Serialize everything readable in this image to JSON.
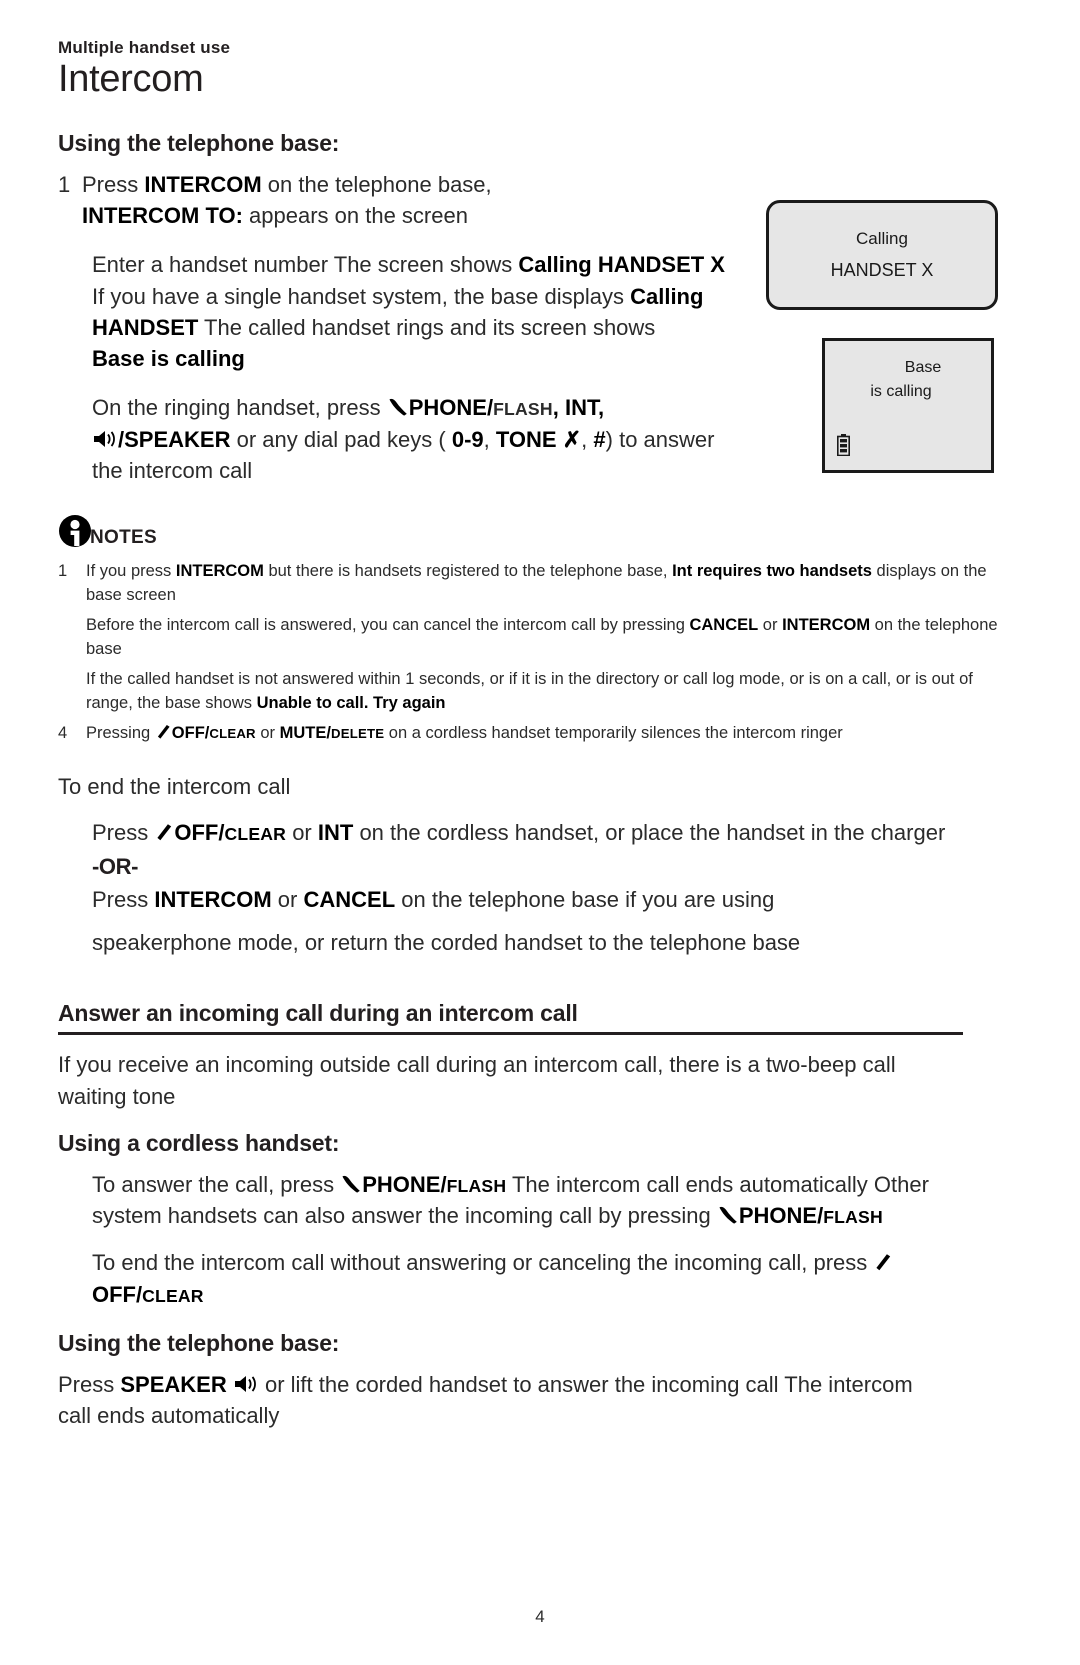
{
  "header": {
    "running_head": "Multiple handset use",
    "chapter_title": "Intercom"
  },
  "section_using_base": {
    "heading": "Using the telephone base:",
    "step1": {
      "number": "1",
      "line1_a": "Press ",
      "line1_b": "INTERCOM",
      "line1_c": " on the telephone base,",
      "line2_b": "INTERCOM TO:",
      "line2_c": " appears on the screen"
    },
    "para2": {
      "a": "Enter a handset number The screen shows ",
      "b": "Calling HANDSET X",
      "c": " If you have a single handset system, the base  displays ",
      "d": "Calling HANDSET",
      "e": " The called handset rings and its screen shows ",
      "f": "Base is calling"
    },
    "para3": {
      "a": "On the ringing handset, press ",
      "phone_icon": "phone-handset-icon",
      "b": "PHONE/",
      "b_sc": "FLASH",
      "c": ", ",
      "d": "INT",
      "e": ", ",
      "speaker_icon": "speaker-icon",
      "f": "/SPEAKER",
      "g": " or any dial pad keys ( ",
      "h": "0",
      "i": "-",
      "j": "9",
      "k": ", ",
      "l": "TONE ",
      "m": "✗",
      "n": ", ",
      "o": "#",
      "p": ") to answer the intercom call"
    }
  },
  "screens": {
    "base_screen": {
      "line1": "Calling",
      "line2": "HANDSET X"
    },
    "handset_screen": {
      "line1": "Base",
      "line2": "is calling",
      "battery_icon": "battery-full-icon"
    }
  },
  "notes": {
    "icon": "info-icon",
    "label": "NOTES",
    "items": [
      {
        "number": "1",
        "parts": [
          {
            "t": "If you press ",
            "b": false
          },
          {
            "t": "INTERCOM",
            "b": true
          },
          {
            "t": " but there is handsets registered to the telephone base, ",
            "b": false
          },
          {
            "t": "  Int requires two handsets",
            "b": true
          },
          {
            "t": " displays on the base screen",
            "b": false
          }
        ]
      },
      {
        "number": "",
        "parts": [
          {
            "t": "Before the intercom call is answered, you can cancel the intercom call by pressing ",
            "b": false
          },
          {
            "t": "  CANCEL",
            "b": true
          },
          {
            "t": " or ",
            "b": false
          },
          {
            "t": "INTERCOM",
            "b": true
          },
          {
            "t": " on the telephone base",
            "b": false
          }
        ]
      },
      {
        "number": "",
        "parts": [
          {
            "t": "If the called handset is not answered within 1 seconds, or if it is in the directory or call log mode, or is on a call, or is out of range, the base shows ",
            "b": false
          },
          {
            "t": "  Unable to call. Try again",
            "b": true
          }
        ]
      }
    ],
    "item4": {
      "number": "4",
      "a": "Pressing ",
      "off_icon": "off-clear-icon",
      "b": "OFF/",
      "b_sc": "CLEAR",
      "c": " or ",
      "d": "MUTE/",
      "d_sc": "DELETE",
      "e": " on a cordless handset temporarily silences the intercom ringer"
    }
  },
  "section_end_call": {
    "intro": "To end the intercom call",
    "p1": {
      "a": "Press ",
      "off_icon": "off-clear-icon",
      "b": "OFF/",
      "b_sc": "CLEAR",
      "c": " or ",
      "d": "INT",
      "e": " on the cordless handset, or place the handset in the charger"
    },
    "or_label": "-OR-",
    "p2": {
      "a": "Press ",
      "b": "INTERCOM",
      "c": " or ",
      "d": "CANCEL",
      "e": " on the telephone base if you are using"
    },
    "p3": "speakerphone mode, or return the corded handset to the telephone base"
  },
  "section_answer_incoming": {
    "heading": "Answer an incoming call during an intercom call",
    "intro": "If you receive an incoming outside call during an intercom call, there is a two-beep call waiting tone",
    "cordless": {
      "heading": "Using a cordless handset:",
      "p1": {
        "a": "To answer the call, press ",
        "phone_icon": "phone-handset-icon",
        "b": "PHONE/",
        "b_sc": "FLASH",
        "c": " The intercom call ends automatically  Other system handsets can   also answer the incoming call by pressing ",
        "d": "PHONE/",
        "d_sc": "FLASH"
      },
      "p2": {
        "a": "To end the intercom call without   answering or canceling   the incoming call, press ",
        "off_icon": "off-clear-icon",
        "b": "OFF/",
        "b_sc": "CLEAR"
      }
    },
    "base": {
      "heading": "Using the telephone base:",
      "p1_a": "Press ",
      "p1_b": "SPEAKER",
      "speaker_icon": "speaker-icon",
      "p1_c": " or lift the corded handset to answer the incoming call The intercom call ends automatically"
    }
  },
  "footer": {
    "page_number": "4"
  }
}
